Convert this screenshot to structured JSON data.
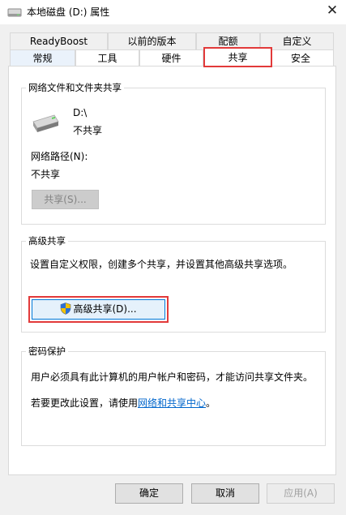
{
  "window": {
    "title": "本地磁盘 (D:) 属性",
    "close_glyph": "✕"
  },
  "tabs_back": [
    "ReadyBoost",
    "以前的版本",
    "配额",
    "自定义"
  ],
  "tabs_front": [
    "常规",
    "工具",
    "硬件",
    "共享",
    "安全"
  ],
  "selected_tab": "共享",
  "network_sharing": {
    "group_label": "网络文件和文件夹共享",
    "drive_name": "D:\\",
    "drive_status": "不共享",
    "network_path_label": "网络路径(N):",
    "network_path_value": "不共享",
    "share_button": "共享(S)..."
  },
  "advanced_sharing": {
    "group_label": "高级共享",
    "description": "设置自定义权限，创建多个共享，并设置其他高级共享选项。",
    "button": "高级共享(D)..."
  },
  "password_protection": {
    "group_label": "密码保护",
    "description": "用户必须具有此计算机的用户帐户和密码，才能访问共享文件夹。",
    "change_prefix": "若要更改此设置，请使用",
    "change_link": "网络和共享中心",
    "change_suffix": "。"
  },
  "buttons": {
    "ok": "确定",
    "cancel": "取消",
    "apply": "应用(A)"
  },
  "colors": {
    "highlight": "#e23a3a",
    "link": "#0066cc",
    "focus_border": "#0078d7"
  }
}
